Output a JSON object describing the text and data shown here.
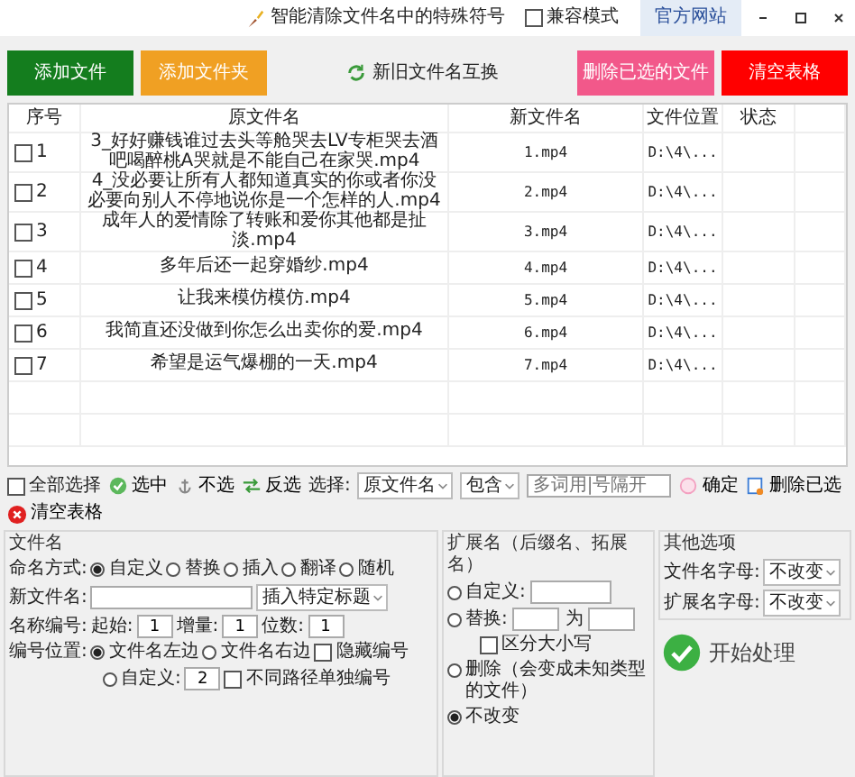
{
  "window": {
    "title": "智能清除文件名中的特殊符号",
    "compat_mode": {
      "label": "兼容模式",
      "checked": false
    },
    "website_link": "官方网站"
  },
  "top_buttons": [
    {
      "label": "添加文件",
      "kind": "filled",
      "color": "#147d1e"
    },
    {
      "label": "添加文件夹",
      "kind": "filled",
      "color": "#f0a023"
    },
    {
      "label": "新旧文件名互换",
      "kind": "plain"
    },
    {
      "label": "删除已选的文件",
      "kind": "filled",
      "color": "#f2588a"
    },
    {
      "label": "清空表格",
      "kind": "filled",
      "color": "#ff0000"
    }
  ],
  "table": {
    "columns": [
      "序号",
      "原文件名",
      "新文件名",
      "文件位置",
      "状态"
    ],
    "rows": [
      {
        "index": "1",
        "checked": false,
        "original": "3_好好赚钱谁过去头等舱哭去LV专柜哭去酒吧喝醉桃A哭就是不能自己在家哭.mp4",
        "new": "1.mp4",
        "location": "D:\\4\\..."
      },
      {
        "index": "2",
        "checked": false,
        "original": "4_没必要让所有人都知道真实的你或者你没必要向别人不停地说你是一个怎样的人.mp4",
        "new": "2.mp4",
        "location": "D:\\4\\..."
      },
      {
        "index": "3",
        "checked": false,
        "original": "成年人的爱情除了转账和爱你其他都是扯淡.mp4",
        "new": "3.mp4",
        "location": "D:\\4\\..."
      },
      {
        "index": "4",
        "checked": false,
        "original": "多年后还一起穿婚纱.mp4",
        "new": "4.mp4",
        "location": "D:\\4\\..."
      },
      {
        "index": "5",
        "checked": false,
        "original": "让我来模仿模仿.mp4",
        "new": "5.mp4",
        "location": "D:\\4\\..."
      },
      {
        "index": "6",
        "checked": false,
        "original": "我简直还没做到你怎么出卖你的爱.mp4",
        "new": "6.mp4",
        "location": "D:\\4\\..."
      },
      {
        "index": "7",
        "checked": false,
        "original": "希望是运气爆棚的一天.mp4",
        "new": "7.mp4",
        "location": "D:\\4\\..."
      }
    ]
  },
  "toolbar": {
    "select_all": {
      "label": "全部选择",
      "checked": false
    },
    "actions": [
      {
        "label": "选中",
        "kind": "check"
      },
      {
        "label": "不选",
        "kind": "anchor"
      },
      {
        "label": "反选",
        "kind": "invert"
      }
    ],
    "select_label": "选择:",
    "field_dropdown": "原文件名",
    "match_dropdown": "包含",
    "keyword_field": {
      "placeholder": "多词用|号隔开"
    },
    "confirm_button": "确定",
    "delete_button": "删除已选",
    "clear_button": "清空表格"
  },
  "filename_group": {
    "title": "文件名",
    "mode_label": "命名方式:",
    "modes": [
      {
        "label": "自定义",
        "selected": true
      },
      {
        "label": "替换",
        "selected": false
      },
      {
        "label": "插入",
        "selected": false
      },
      {
        "label": "翻译",
        "selected": false
      },
      {
        "label": "随机",
        "selected": false
      }
    ],
    "new_name_label": "新文件名:",
    "insert_dropdown": "插入特定标题",
    "numbering_label": "名称编号:",
    "numbering_fields": [
      {
        "label": "起始:",
        "value": "1"
      },
      {
        "label": "增量:",
        "value": "1"
      },
      {
        "label": "位数:",
        "value": "1"
      }
    ],
    "position_label": "编号位置:",
    "positions": [
      {
        "label": "文件名左边",
        "selected": true
      },
      {
        "label": "文件名右边",
        "selected": false
      },
      {
        "label": "自定义:",
        "selected": false,
        "value": "2"
      }
    ],
    "hide_number": {
      "label": "隐藏编号",
      "checked": false
    },
    "separate_numbering": {
      "label": "不同路径单独编号",
      "checked": false
    }
  },
  "extension_group": {
    "title": "扩展名（后缀名、拓展名）",
    "options": [
      {
        "kind": "custom",
        "label": "自定义:",
        "selected": false
      },
      {
        "kind": "replace",
        "label": "替换:",
        "between": "为",
        "selected": false
      },
      {
        "kind": "plain",
        "label": "删除（会变成未知类型的文件）",
        "selected": false
      },
      {
        "kind": "plain",
        "label": "不改变",
        "selected": true
      }
    ],
    "case_sensitive": {
      "label": "区分大小写",
      "checked": false
    }
  },
  "other_group": {
    "title": "其他选项",
    "fields": [
      {
        "label": "文件名字母:",
        "value": "不改变"
      },
      {
        "label": "扩展名字母:",
        "value": "不改变"
      }
    ]
  },
  "start_button": "开始处理"
}
